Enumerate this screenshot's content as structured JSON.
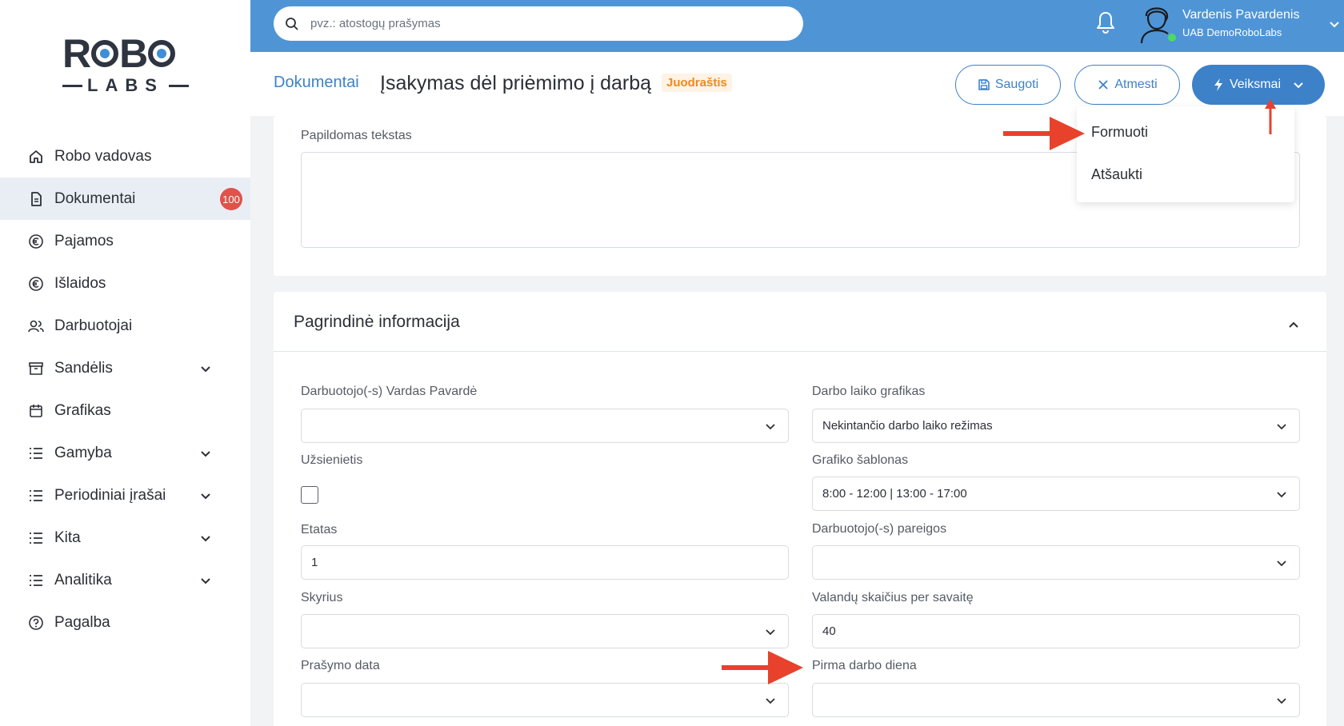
{
  "brand": {
    "logo_top": "ROBO",
    "logo_bottom": "LABS"
  },
  "sidebar": {
    "items": [
      {
        "label": "Robo vadovas",
        "icon": "home-icon"
      },
      {
        "label": "Dokumentai",
        "icon": "document-icon",
        "badge": "100",
        "active": true
      },
      {
        "label": "Pajamos",
        "icon": "euro-icon"
      },
      {
        "label": "Išlaidos",
        "icon": "euro-icon"
      },
      {
        "label": "Darbuotojai",
        "icon": "users-icon"
      },
      {
        "label": "Sandėlis",
        "icon": "archive-icon",
        "expandable": true
      },
      {
        "label": "Grafikas",
        "icon": "calendar-icon"
      },
      {
        "label": "Gamyba",
        "icon": "list-icon",
        "expandable": true
      },
      {
        "label": "Periodiniai įrašai",
        "icon": "list-icon",
        "expandable": true
      },
      {
        "label": "Kita",
        "icon": "list-icon",
        "expandable": true
      },
      {
        "label": "Analitika",
        "icon": "list-icon",
        "expandable": true
      },
      {
        "label": "Pagalba",
        "icon": "help-icon"
      }
    ]
  },
  "topbar": {
    "search_placeholder": "pvz.: atostogų prašymas",
    "user_name": "Vardenis Pavardenis",
    "user_company": "UAB DemoRoboLabs"
  },
  "header": {
    "breadcrumb": "Dokumentai",
    "title": "Įsakymas dėl priėmimo į darbą",
    "status": "Juodraštis",
    "save_label": "Saugoti",
    "reject_label": "Atmesti",
    "actions_label": "Veiksmai"
  },
  "actions_menu": {
    "items": [
      "Formuoti",
      "Atšaukti"
    ]
  },
  "form": {
    "extra_text_label": "Papildomas tekstas",
    "section_title": "Pagrindinė informacija",
    "employee_name_label": "Darbuotojo(-s) Vardas Pavardė",
    "employee_name_value": "",
    "foreigner_label": "Užsienietis",
    "rate_label": "Etatas",
    "rate_value": "1",
    "department_label": "Skyrius",
    "department_value": "",
    "request_date_label": "Prašymo data",
    "request_date_value": "",
    "schedule_label": "Darbo laiko grafikas",
    "schedule_value": "Nekintančio darbo laiko režimas",
    "template_label": "Grafiko šablonas",
    "template_value": "8:00 - 12:00 | 13:00 - 17:00",
    "duties_label": "Darbuotojo(-s) pareigos",
    "duties_value": "",
    "hours_label": "Valandų skaičius per savaitę",
    "hours_value": "40",
    "first_day_label": "Pirma darbo diena",
    "first_day_value": ""
  },
  "colors": {
    "primary": "#3d82c8",
    "topbar": "#4f95d6",
    "badge": "#e0524a",
    "draft": "#f08a1c",
    "annotation": "#e8412c"
  }
}
